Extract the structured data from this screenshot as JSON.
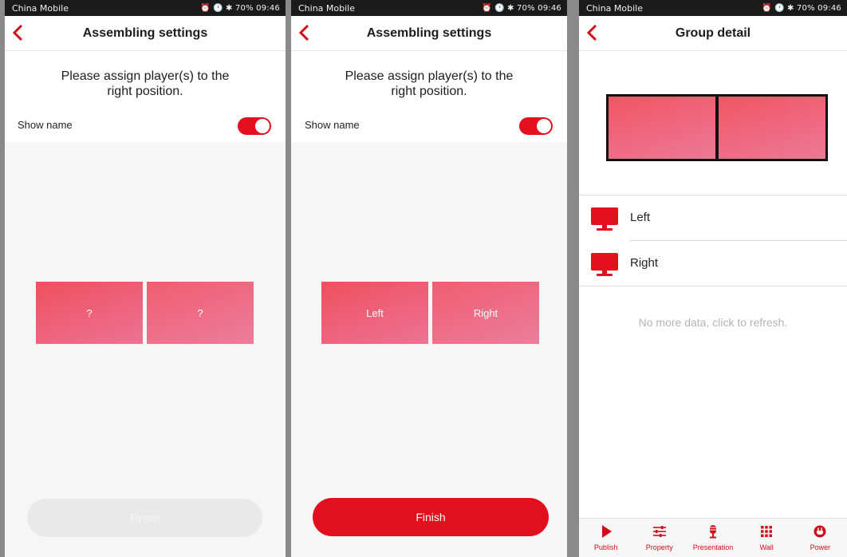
{
  "status_bar": {
    "carrier": "China Mobile",
    "right_indicators": "⏰ 🕐 ✱ 70% 09:46",
    "battery": "70%",
    "time": "09:46"
  },
  "screens": {
    "assembling_before": {
      "title": "Assembling settings",
      "instruction_line1": "Please assign player(s) to the",
      "instruction_line2": "right position.",
      "show_name_label": "Show name",
      "show_name_on": true,
      "tiles": [
        "?",
        "?"
      ],
      "finish_label": "Finish",
      "finish_enabled": false
    },
    "assembling_after": {
      "title": "Assembling settings",
      "instruction_line1": "Please assign player(s) to the",
      "instruction_line2": "right position.",
      "show_name_label": "Show name",
      "show_name_on": true,
      "tiles": [
        "Left",
        "Right"
      ],
      "finish_label": "Finish",
      "finish_enabled": true
    },
    "group_detail": {
      "title": "Group detail",
      "devices": [
        {
          "name": "Left",
          "icon": "monitor-icon"
        },
        {
          "name": "Right",
          "icon": "monitor-icon"
        }
      ],
      "refresh_text": "No more data, click to refresh.",
      "tabs": [
        {
          "label": "Publish",
          "icon": "play-icon"
        },
        {
          "label": "Property",
          "icon": "sliders-icon"
        },
        {
          "label": "Presentation",
          "icon": "microphone-icon"
        },
        {
          "label": "Wall",
          "icon": "grid-icon"
        },
        {
          "label": "Power",
          "icon": "power-icon"
        }
      ]
    }
  },
  "colors": {
    "accent": "#e4101e",
    "tile_gradient_start": "#f04f5e",
    "tile_gradient_end": "#ec7393",
    "disabled_button": "#e9e9e9",
    "hint_text": "#b4b4b4"
  }
}
